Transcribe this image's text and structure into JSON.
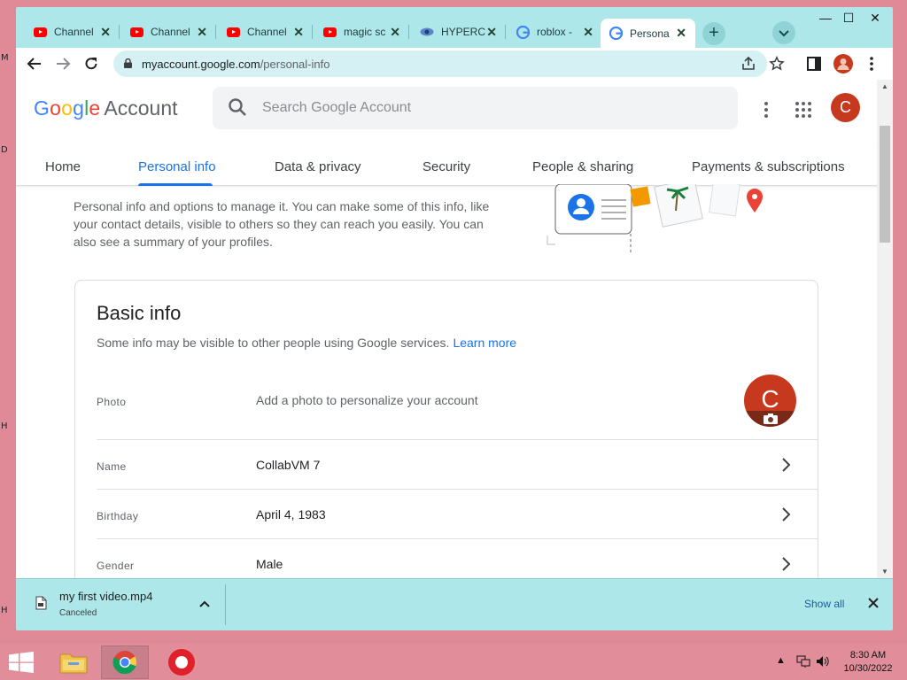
{
  "desktop": {
    "edge_letters": [
      "M",
      "D",
      "H",
      "H"
    ]
  },
  "browser": {
    "tabs": [
      {
        "title": "Channel",
        "icon": "youtube-icon",
        "active": false
      },
      {
        "title": "Channel",
        "icon": "youtube-icon",
        "active": false
      },
      {
        "title": "Channel",
        "icon": "youtube-icon",
        "active": false
      },
      {
        "title": "magic sc",
        "icon": "youtube-icon",
        "active": false
      },
      {
        "title": "HYPERC",
        "icon": "eye-icon",
        "active": false
      },
      {
        "title": "roblox -",
        "icon": "google-icon",
        "active": false
      },
      {
        "title": "Persona",
        "icon": "google-icon",
        "active": true
      }
    ],
    "tab_close_glyph": "✕",
    "new_tab_glyph": "+",
    "url_host": "myaccount.google.com",
    "url_path": "/personal-info",
    "window_controls": {
      "minimize": "—",
      "maximize": "☐",
      "close": "✕"
    }
  },
  "header": {
    "logo_google": "Google",
    "logo_account": "Account",
    "search_placeholder": "Search Google Account",
    "avatar_letter": "C"
  },
  "nav": {
    "items": [
      "Home",
      "Personal info",
      "Data & privacy",
      "Security",
      "People & sharing",
      "Payments & subscriptions"
    ],
    "active": "Personal info"
  },
  "intro": "Personal info and options to manage it. You can make some of this info, like your contact details, visible to others so they can reach you easily. You can also see a summary of your profiles.",
  "basic_info": {
    "title": "Basic info",
    "subtitle": "Some info may be visible to other people using Google services.",
    "learn_more": "Learn more",
    "photo_label": "Photo",
    "photo_value": "Add a photo to personalize your account",
    "photo_letter": "C",
    "rows": [
      {
        "label": "Name",
        "value": "CollabVM 7"
      },
      {
        "label": "Birthday",
        "value": "April 4, 1983"
      },
      {
        "label": "Gender",
        "value": "Male"
      }
    ]
  },
  "downloads": {
    "file_name": "my first video.mp4",
    "status": "Canceled",
    "show_all": "Show all"
  },
  "taskbar": {
    "time": "8:30 AM",
    "date": "10/30/2022"
  },
  "colors": {
    "accent_blue": "#1a73e8",
    "avatar_red": "#c6391f",
    "chrome_frame": "#aee7ea",
    "desktop_pink": "#e08a98"
  }
}
